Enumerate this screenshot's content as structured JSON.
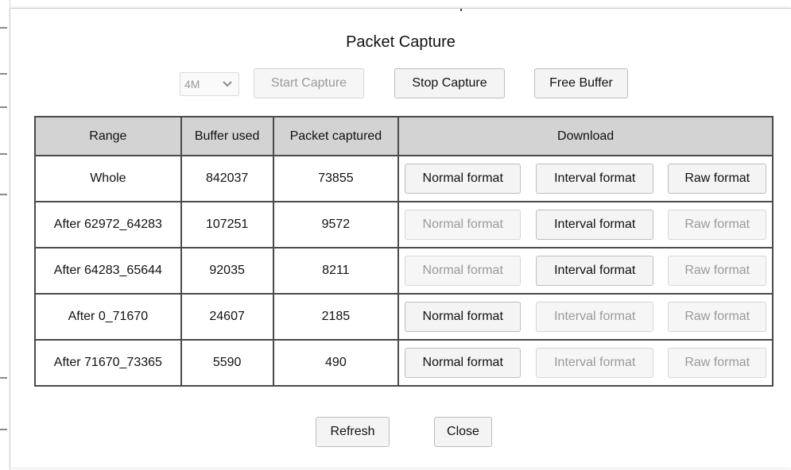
{
  "dialog": {
    "title": "Packet Capture",
    "size_select": {
      "value": "4M",
      "disabled": true
    },
    "toolbar": {
      "start_capture": {
        "label": "Start Capture",
        "enabled": false
      },
      "stop_capture": {
        "label": "Stop Capture",
        "enabled": true
      },
      "free_buffer": {
        "label": "Free Buffer",
        "enabled": true
      }
    },
    "table": {
      "headers": [
        "Range",
        "Buffer used",
        "Packet captured",
        "Download"
      ],
      "rows": [
        {
          "range": "Whole",
          "buffer_used": "842037",
          "packets": "73855",
          "normal": {
            "label": "Normal format",
            "enabled": true
          },
          "interval": {
            "label": "Interval format",
            "enabled": true
          },
          "raw": {
            "label": "Raw format",
            "enabled": true
          }
        },
        {
          "range": "After 62972_64283",
          "buffer_used": "107251",
          "packets": "9572",
          "normal": {
            "label": "Normal format",
            "enabled": false
          },
          "interval": {
            "label": "Interval format",
            "enabled": true
          },
          "raw": {
            "label": "Raw format",
            "enabled": false
          }
        },
        {
          "range": "After 64283_65644",
          "buffer_used": "92035",
          "packets": "8211",
          "normal": {
            "label": "Normal format",
            "enabled": false
          },
          "interval": {
            "label": "Interval format",
            "enabled": true
          },
          "raw": {
            "label": "Raw format",
            "enabled": false
          }
        },
        {
          "range": "After 0_71670",
          "buffer_used": "24607",
          "packets": "2185",
          "normal": {
            "label": "Normal format",
            "enabled": true
          },
          "interval": {
            "label": "Interval format",
            "enabled": false
          },
          "raw": {
            "label": "Raw format",
            "enabled": false
          }
        },
        {
          "range": "After 71670_73365",
          "buffer_used": "5590",
          "packets": "490",
          "normal": {
            "label": "Normal format",
            "enabled": true
          },
          "interval": {
            "label": "Interval format",
            "enabled": false
          },
          "raw": {
            "label": "Raw format",
            "enabled": false
          }
        }
      ]
    },
    "footer": {
      "refresh": "Refresh",
      "close": "Close"
    }
  },
  "icons": {
    "select_chevron": "chevron-down-icon"
  }
}
